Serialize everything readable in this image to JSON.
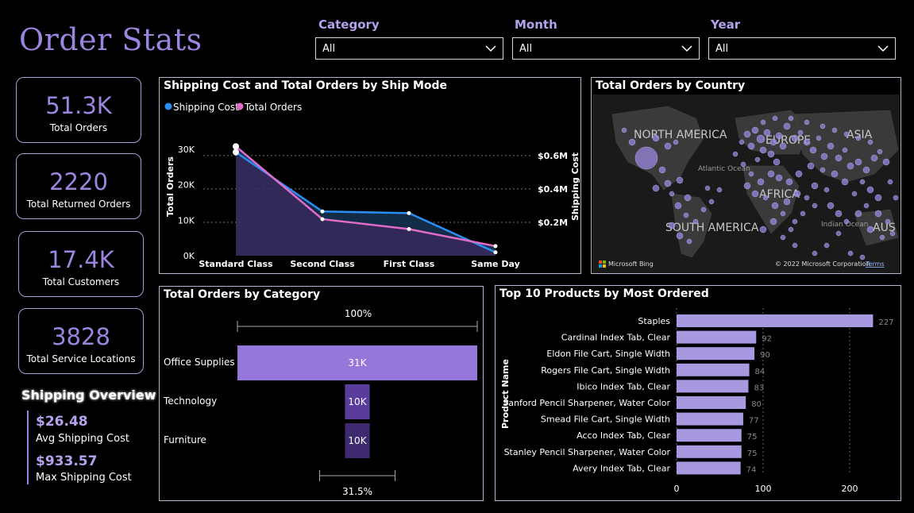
{
  "page_title": "Order Stats",
  "filters": [
    {
      "label": "Category",
      "value": "All"
    },
    {
      "label": "Month",
      "value": "All"
    },
    {
      "label": "Year",
      "value": "All"
    }
  ],
  "kpis": [
    {
      "value": "51.3K",
      "label": "Total Orders"
    },
    {
      "value": "2220",
      "label": "Total Returned Orders"
    },
    {
      "value": "17.4K",
      "label": "Total Customers"
    },
    {
      "value": "3828",
      "label": "Total Service Locations"
    }
  ],
  "shipping_overview": {
    "heading": "Shipping Overview",
    "avg_value": "$26.48",
    "avg_label": "Avg Shipping Cost",
    "max_value": "$933.57",
    "max_label": "Max Shipping Cost"
  },
  "ship_mode_chart": {
    "title": "Shipping Cost and Total Orders by Ship Mode",
    "legend": [
      {
        "name": "Shipping Cost",
        "color": "#2a8ff2"
      },
      {
        "name": "Total Orders",
        "color": "#e06bc8"
      }
    ],
    "y_left_label": "Total Orders",
    "y_right_label": "Shipping Cost",
    "y_left_ticks": [
      "0K",
      "10K",
      "20K",
      "30K"
    ],
    "y_right_ticks": [
      "$0.2M",
      "$0.4M",
      "$0.6M"
    ]
  },
  "map_panel": {
    "title": "Total Orders by Country",
    "labels": [
      "NORTH AMERICA",
      "EUROPE",
      "ASIA",
      "SOUTH AMERICA",
      "AFRICA",
      "AUS",
      "Atlantic Ocean",
      "Indian Ocean"
    ],
    "brand": "Microsoft Bing",
    "copyright": "© 2022 Microsoft Corporation",
    "terms": "Terms"
  },
  "category_chart": {
    "title": "Total Orders by Category",
    "top_pct": "100%",
    "bottom_pct": "31.5%"
  },
  "top_products_chart": {
    "title": "Top 10 Products by Most Ordered",
    "y_label": "Product Name",
    "x_ticks": [
      "0",
      "100",
      "200"
    ]
  },
  "chart_data": [
    {
      "type": "line",
      "title": "Shipping Cost and Total Orders by Ship Mode",
      "x": [
        "Standard Class",
        "Second Class",
        "First Class",
        "Same Day"
      ],
      "series": [
        {
          "name": "Shipping Cost",
          "axis": "right",
          "values": [
            620000,
            265000,
            255000,
            20000
          ]
        },
        {
          "name": "Total Orders",
          "axis": "left",
          "values": [
            30800,
            10300,
            7500,
            2700
          ]
        }
      ],
      "ylabel": "Total Orders",
      "ylabel_right": "Shipping Cost",
      "ylim": [
        0,
        32000
      ],
      "ylim_right": [
        0,
        680000
      ],
      "grid": true
    },
    {
      "type": "bar",
      "title": "Total Orders by Category",
      "categories": [
        "Office Supplies",
        "Technology",
        "Furniture"
      ],
      "values": [
        31000,
        10000,
        10000
      ],
      "data_labels": [
        "31K",
        "10K",
        "10K"
      ],
      "colors": [
        "#9577dc",
        "#5a3c9c",
        "#3e2a6e"
      ]
    },
    {
      "type": "bar",
      "title": "Top 10 Products by Most Ordered",
      "orientation": "horizontal",
      "ylabel": "Product Name",
      "categories": [
        "Staples",
        "Cardinal Index Tab, Clear",
        "Eldon File Cart, Single Width",
        "Rogers File Cart, Single Width",
        "Ibico Index Tab, Clear",
        "Sanford Pencil Sharpener, Water Color",
        "Smead File Cart, Single Width",
        "Acco Index Tab, Clear",
        "Stanley Pencil Sharpener, Water Color",
        "Avery Index Tab, Clear"
      ],
      "values": [
        227,
        92,
        90,
        84,
        83,
        80,
        77,
        75,
        75,
        74
      ],
      "xlim": [
        0,
        250
      ],
      "grid": true
    }
  ]
}
